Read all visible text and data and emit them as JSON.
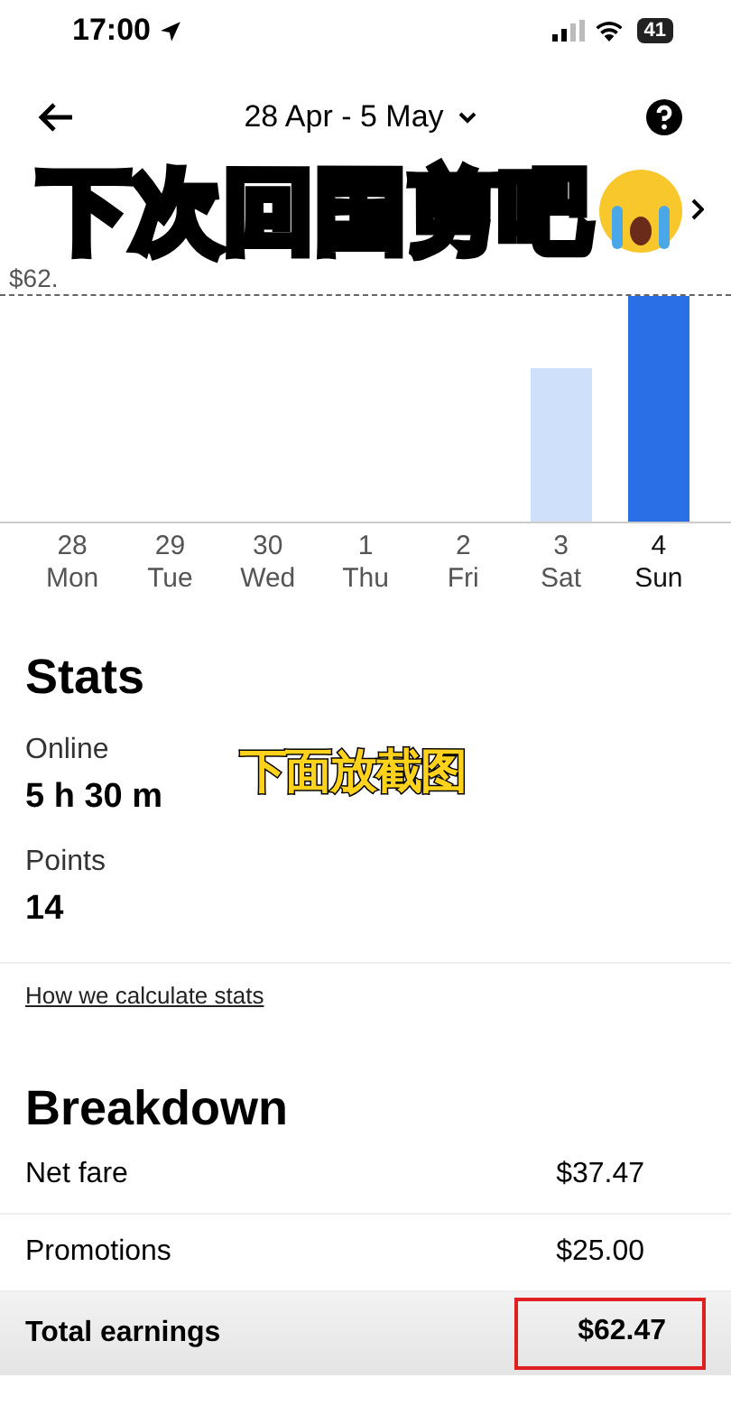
{
  "status_bar": {
    "time": "17:00",
    "battery": "41"
  },
  "header": {
    "date_range": "28 Apr - 5 May"
  },
  "caption": {
    "text": "下次回国剪吧"
  },
  "chart": {
    "max_label": "$62.",
    "days": [
      {
        "date": "28",
        "day": "Mon",
        "kind": "empty",
        "selected": false
      },
      {
        "date": "29",
        "day": "Tue",
        "kind": "empty",
        "selected": false
      },
      {
        "date": "30",
        "day": "Wed",
        "kind": "empty",
        "selected": false
      },
      {
        "date": "1",
        "day": "Thu",
        "kind": "empty",
        "selected": false
      },
      {
        "date": "2",
        "day": "Fri",
        "kind": "empty",
        "selected": false
      },
      {
        "date": "3",
        "day": "Sat",
        "kind": "partial",
        "selected": false
      },
      {
        "date": "4",
        "day": "Sun",
        "kind": "full",
        "selected": true
      }
    ]
  },
  "stats": {
    "title": "Stats",
    "items": [
      {
        "label": "Online",
        "value": "5 h 30 m"
      },
      {
        "label": "Points",
        "value": "14"
      }
    ],
    "link": "How we calculate stats"
  },
  "sticker": {
    "text": "下面放截图"
  },
  "breakdown": {
    "title": "Breakdown",
    "rows": [
      {
        "label": "Net fare",
        "value": "$37.47"
      },
      {
        "label": "Promotions",
        "value": "$25.00"
      }
    ],
    "total": {
      "label": "Total earnings",
      "value": "$62.47",
      "highlighted": true
    }
  }
}
